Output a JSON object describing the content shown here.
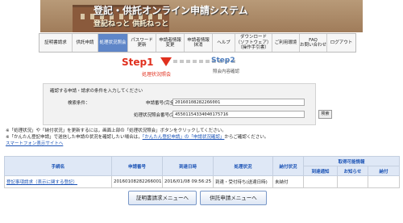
{
  "header": {
    "title": "登記・供託オンライン申請システム",
    "subtitle": "登記ねっと 供託ねっと"
  },
  "nav": [
    {
      "label": "証明書請求",
      "active": false
    },
    {
      "label": "供託申請",
      "active": false
    },
    {
      "label": "処理状況照会",
      "active": true
    },
    {
      "label": "パスワード\n更新",
      "active": false
    },
    {
      "label": "申請者情報\n変更",
      "active": false
    },
    {
      "label": "申請者情報\n抹消",
      "active": false
    },
    {
      "label": "ヘルプ",
      "active": false
    },
    {
      "label": "ダウンロード\n（ソフトウェア）\n（操作手引書）",
      "active": false
    },
    {
      "label": "ご利用環境",
      "active": false
    },
    {
      "label": "FAQ\nお問い合わせ",
      "active": false
    },
    {
      "label": "ログアウト",
      "active": false
    }
  ],
  "steps": {
    "step1": "Step1",
    "step1_label": "処理状況照会",
    "step2": "Step2",
    "step2_label": "照会内容確認"
  },
  "search": {
    "instruction": "確認する申請・請求の条件を入力してください",
    "conditions_label": "検索条件：",
    "field1_label": "申請番号(完全一致)",
    "field1_value": "20160108282266001",
    "field2_label": "処理状況照会番号(完全一致)",
    "field2_value": "4550115433404017571­6",
    "button": "検索"
  },
  "notes": {
    "line1": "※「処理状況」や「納付状況」を更新するには，画面上部の「処理状況照会」ボタンをクリックしてください。",
    "line2_pre": "※「かんたん登記申請」で送信した申請の状況を確認したい場合は，",
    "line2_link1": "「かんたん登記申請」の「申請状況確認」",
    "line2_post": "からご確認ください。",
    "link": "スマートフォン表示サイトへ"
  },
  "table": {
    "headers": [
      "手続名",
      "申請番号",
      "到達日時",
      "処理状況",
      "納付状況",
      "取得可能情報"
    ],
    "subheaders": [
      "到達通知",
      "お知らせ",
      "納付"
    ],
    "rows": [
      {
        "procedure": "登記事項請求（表示に関する登記）",
        "app_no": "20160108282266001",
        "arrived": "2016/01/08 09:56:25",
        "status": "到達・受付待ち(送達日時)",
        "payment": "未納付",
        "notice": "",
        "info": "",
        "pay": ""
      }
    ]
  },
  "buttons": {
    "cert_menu": "証明書請求メニューへ",
    "deposit_menu": "供託申請メニューへ"
  }
}
